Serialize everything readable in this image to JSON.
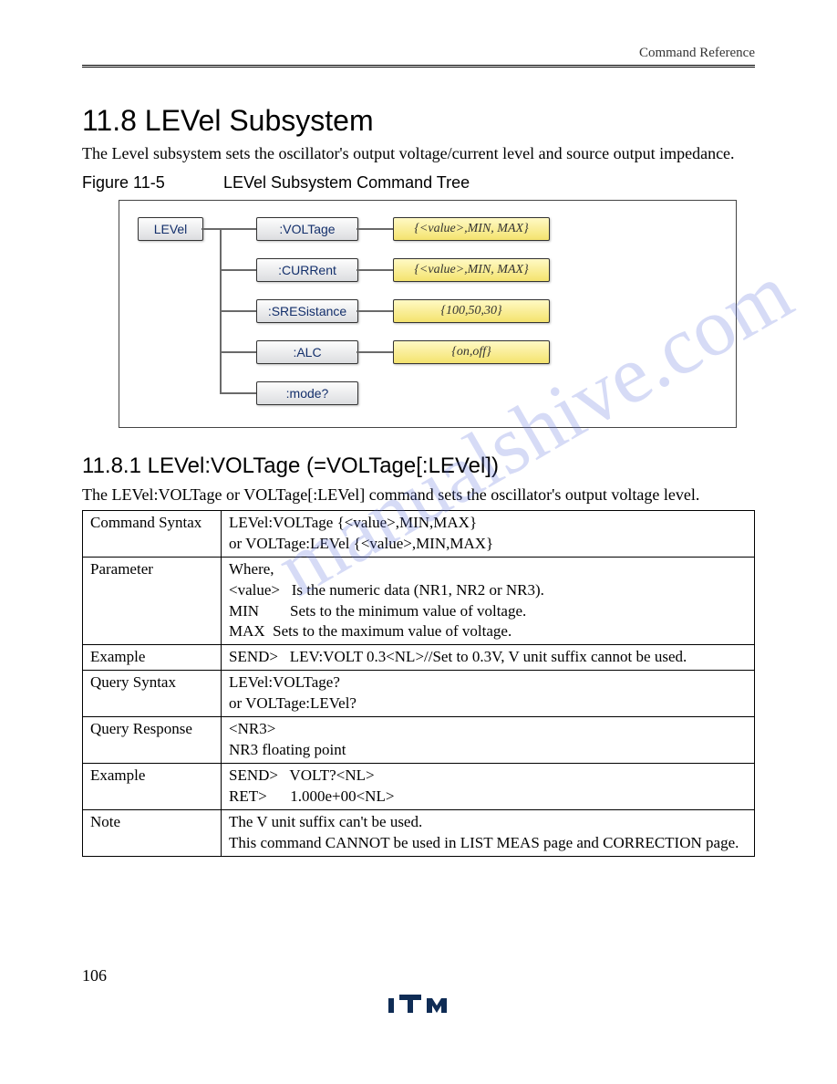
{
  "header": {
    "running": "Command Reference"
  },
  "section": {
    "title": "11.8 LEVel Subsystem",
    "intro": "The Level subsystem sets the oscillator's output voltage/current level and source output impedance."
  },
  "figure": {
    "number": "Figure 11-5",
    "title": "LEVel Subsystem Command Tree",
    "root": "LEVel",
    "nodes": [
      {
        "cmd": ":VOLTage",
        "param": "{<value>,MIN, MAX}"
      },
      {
        "cmd": ":CURRent",
        "param": "{<value>,MIN, MAX}"
      },
      {
        "cmd": ":SRESistance",
        "param": "{100,50,30}"
      },
      {
        "cmd": ":ALC",
        "param": "{on,off}"
      },
      {
        "cmd": ":mode?",
        "param": null
      }
    ]
  },
  "subsection": {
    "title": "11.8.1 LEVel:VOLTage (=VOLTage[:LEVel])",
    "intro": "The LEVel:VOLTage or VOLTage[:LEVel] command sets the oscillator's output voltage level."
  },
  "table": {
    "rows": [
      {
        "label": "Command Syntax",
        "value": "LEVel:VOLTage {<value>,MIN,MAX}\nor VOLTage:LEVel {<value>,MIN,MAX}"
      },
      {
        "label": "Parameter",
        "value": "Where,\n<value>   Is the numeric data (NR1, NR2 or NR3).\nMIN        Sets to the minimum value of voltage.\nMAX  Sets to the maximum value of voltage."
      },
      {
        "label": "Example",
        "value": "SEND>   LEV:VOLT 0.3<NL>//Set to 0.3V, V unit suffix cannot be used."
      },
      {
        "label": "Query Syntax",
        "value": "LEVel:VOLTage?\nor VOLTage:LEVel?"
      },
      {
        "label": "Query Response",
        "value": "<NR3>\nNR3 floating point"
      },
      {
        "label": "Example",
        "value": "SEND>   VOLT?<NL>\nRET>      1.000e+00<NL>"
      },
      {
        "label": "Note",
        "value": "The V unit suffix can't be used.\nThis command CANNOT be used in LIST MEAS page and CORRECTION page."
      }
    ]
  },
  "page_number": "106",
  "watermark": "manualshive.com"
}
